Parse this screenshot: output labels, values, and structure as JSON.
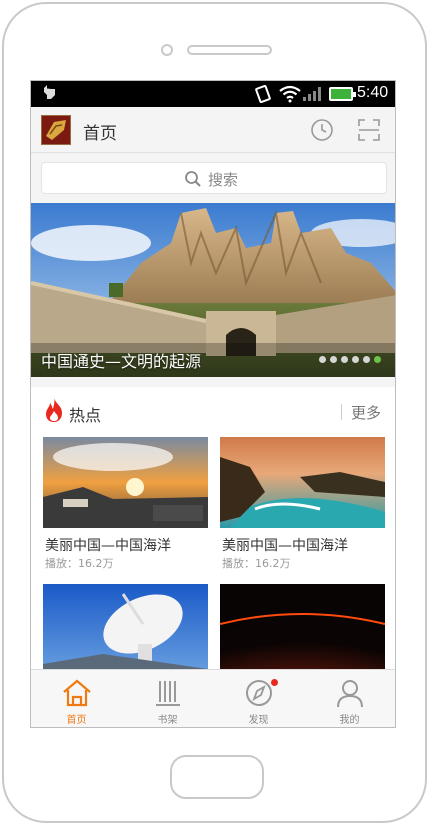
{
  "status_bar": {
    "time": "5:40"
  },
  "header": {
    "title": "首页"
  },
  "search": {
    "placeholder": "搜索"
  },
  "banner": {
    "caption": "中国通史—文明的起源",
    "slide_count": 6,
    "active_slide": 6
  },
  "hot": {
    "title": "热点",
    "more_label": "更多",
    "items": [
      {
        "title": "美丽中国—中国海洋",
        "plays": "播放：16.2万"
      },
      {
        "title": "美丽中国—中国海洋",
        "plays": "播放：16.2万"
      },
      {
        "title": "",
        "plays": ""
      },
      {
        "title": "",
        "plays": ""
      }
    ]
  },
  "bottom_nav": {
    "items": [
      {
        "label": "首页",
        "icon": "home-icon",
        "active": true
      },
      {
        "label": "书架",
        "icon": "bookshelf-icon",
        "active": false
      },
      {
        "label": "发现",
        "icon": "compass-icon",
        "active": false,
        "badge": true
      },
      {
        "label": "我的",
        "icon": "person-icon",
        "active": false
      }
    ]
  },
  "colors": {
    "accent": "#f07a12",
    "dot_active": "#6dc24b",
    "badge": "#e8281e",
    "fire": "#e8281e"
  }
}
